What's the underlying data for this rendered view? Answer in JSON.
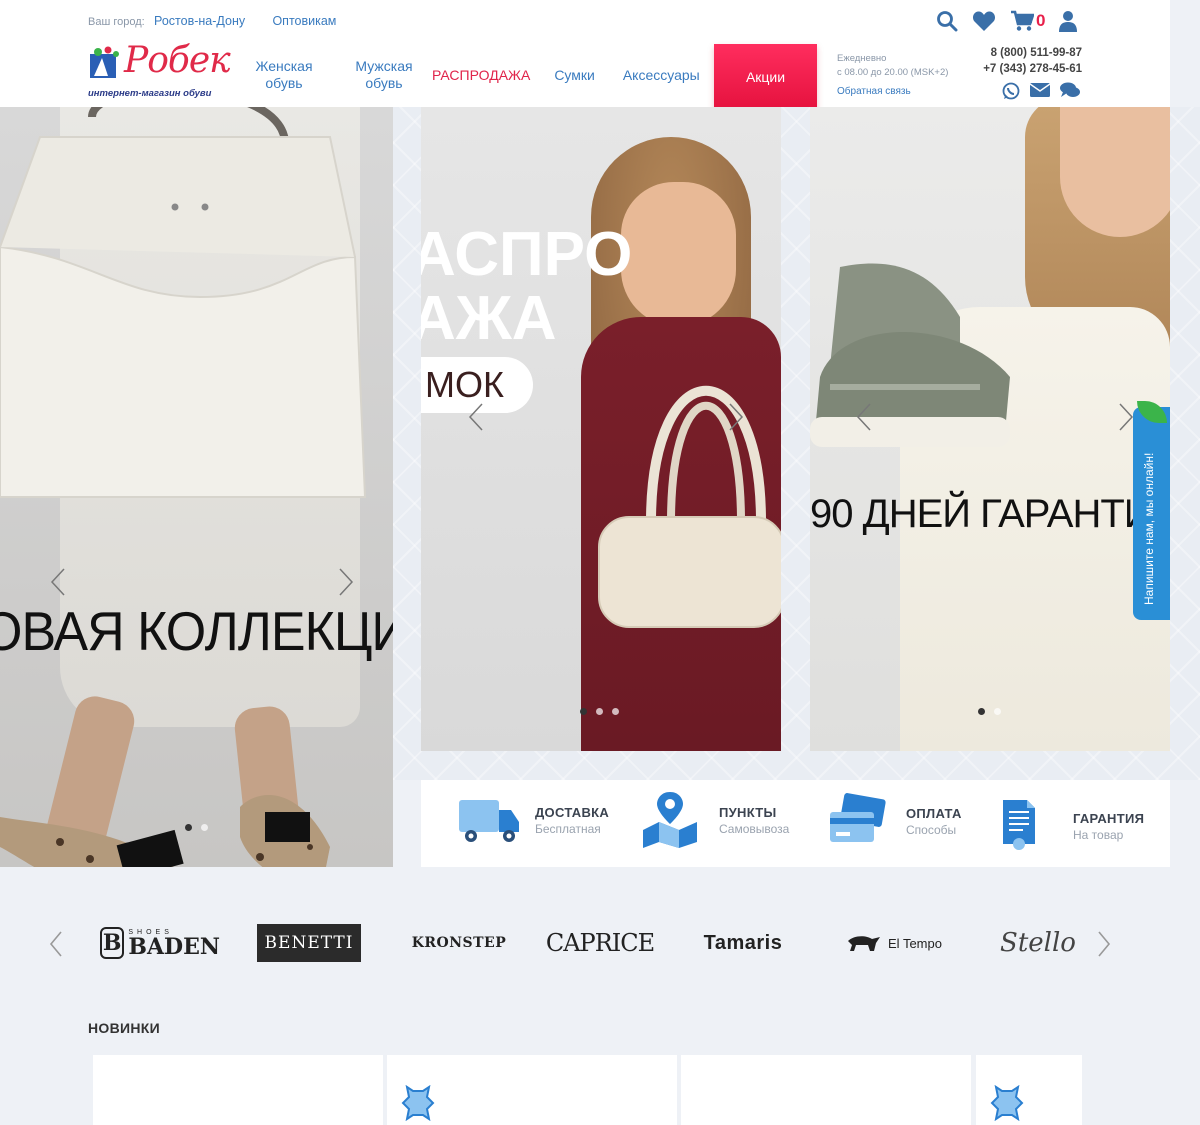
{
  "header": {
    "city_label": "Ваш город:",
    "city": "Ростов-на-Дону",
    "wholesale": "Оптовикам",
    "cart_count": "0",
    "logo_word": "Робек",
    "logo_tagline": "интернет-магазин обуви",
    "nav": [
      {
        "line1": "Женская",
        "line2": "обувь"
      },
      {
        "line1": "Мужская",
        "line2": "обувь"
      },
      {
        "line1": "РАСПРОДАЖА",
        "line2": ""
      },
      {
        "line1": "Сумки",
        "line2": ""
      },
      {
        "line1": "Аксессуары",
        "line2": ""
      }
    ],
    "promo": "Акции",
    "hours_line1": "Ежедневно",
    "hours_line2": "с 08.00 до 20.00 (MSK+2)",
    "feedback": "Обратная связь",
    "phone1": "8 (800) 511-99-87",
    "phone2": "+7 (343) 278-45-61"
  },
  "hero": {
    "slide1_text": "ОВАЯ КОЛЛЕКЦИ",
    "slide2_line1": "АСПРО",
    "slide2_line2": "АЖА",
    "slide2_pill": "МОК",
    "slide3_text": "90 ДНЕЙ ГАРАНТИ"
  },
  "features": [
    {
      "title": "ДОСТАВКА",
      "sub": "Бесплатная",
      "icon": "truck-icon"
    },
    {
      "title": "ПУНКТЫ",
      "sub": "Самовывоза",
      "icon": "map-pin-icon"
    },
    {
      "title": "ОПЛАТА",
      "sub": "Способы",
      "icon": "credit-card-icon"
    },
    {
      "title": "ГАРАНТИЯ",
      "sub": "На товар",
      "icon": "certificate-icon"
    }
  ],
  "brands": [
    "BADEN",
    "BENETTI",
    "KRONSTEP",
    "CAPRICE",
    "Tamaris",
    "El Tempo",
    "Stello"
  ],
  "brand_small": "SHOES",
  "new_title": "НОВИНКИ",
  "chat_tab": "Напишите нам, мы онлайн!",
  "colors": {
    "accent": "#3a7bbf",
    "sale": "#e0244a",
    "promo": "#ff2d5e",
    "chat": "#2a8fd6"
  }
}
